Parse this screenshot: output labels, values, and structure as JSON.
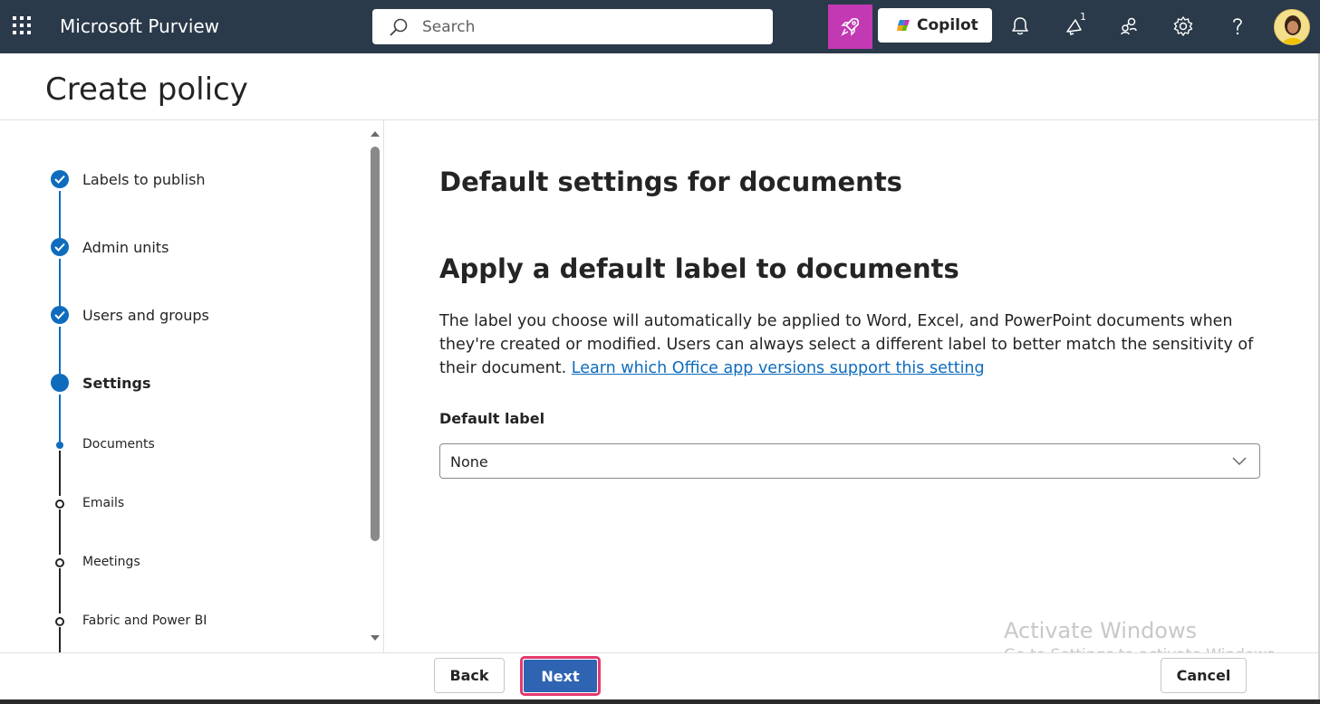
{
  "topbar": {
    "app_name": "Microsoft Purview",
    "search_placeholder": "Search",
    "copilot_label": "Copilot",
    "notification_count": "1",
    "bg_color": "#2b3a4a",
    "accent_pink": "#c239b3"
  },
  "page": {
    "title": "Create policy"
  },
  "steps": [
    {
      "label": "Labels to publish",
      "state": "completed"
    },
    {
      "label": "Admin units",
      "state": "completed"
    },
    {
      "label": "Users and groups",
      "state": "completed"
    },
    {
      "label": "Settings",
      "state": "current"
    },
    {
      "label": "Documents",
      "state": "current-sub"
    },
    {
      "label": "Emails",
      "state": "pending-sub"
    },
    {
      "label": "Meetings",
      "state": "pending-sub"
    },
    {
      "label": "Fabric and Power BI",
      "state": "pending-sub"
    }
  ],
  "main": {
    "heading": "Default settings for documents",
    "subheading": "Apply a default label to documents",
    "description": "The label you choose will automatically be applied to Word, Excel, and PowerPoint documents when they're created or modified. Users can always select a different label to better match the sensitivity of their document.",
    "link_text": "Learn which Office app versions support this setting",
    "field_label": "Default label",
    "dropdown_value": "None"
  },
  "footer": {
    "back_label": "Back",
    "next_label": "Next",
    "cancel_label": "Cancel"
  },
  "watermark": {
    "line1": "Activate Windows",
    "line2": "Go to Settings to activate Windows."
  },
  "colors": {
    "primary_blue": "#0f6cbd",
    "next_button": "#2f64b3",
    "highlight_border": "#e5396d"
  }
}
